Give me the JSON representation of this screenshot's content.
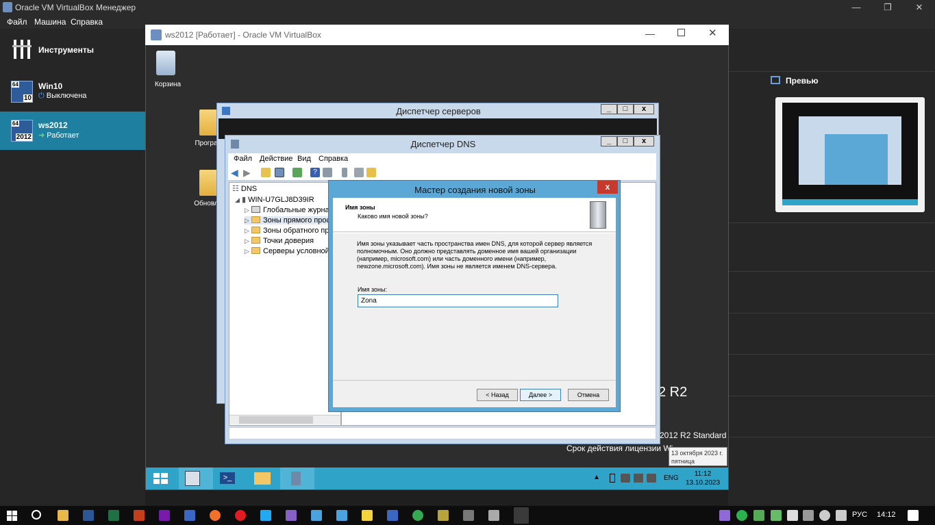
{
  "host_window": {
    "title": "Oracle VM VirtualBox Менеджер",
    "menu": [
      "Файл",
      "Машина",
      "Справка"
    ]
  },
  "sidebar": {
    "tools_label": "Инструменты",
    "vms": [
      {
        "name": "Win10",
        "state": "Выключена",
        "version_badge": "10",
        "arch_badge": "64"
      },
      {
        "name": "ws2012",
        "state": "Работает",
        "version_badge": "2012",
        "arch_badge": "64"
      }
    ]
  },
  "preview": {
    "label": "Превью"
  },
  "vm_window": {
    "title": "ws2012 [Работает] - Oracle VM VirtualBox"
  },
  "guest_desktop": {
    "recycle_bin_label": "Корзина",
    "folder1_label": "Програ",
    "folder2_label": "Обновл",
    "brand_text": "2 R2",
    "edition_text": "2012 R2 Standard",
    "license_text": "Срок действия лицензии Wi",
    "tooltip_line1": "13 октября 2023 г.",
    "tooltip_line2": "пятница"
  },
  "server_manager": {
    "title": "Диспетчер серверов"
  },
  "dns_manager": {
    "title": "Диспетчер DNS",
    "menu": [
      "Файл",
      "Действие",
      "Вид",
      "Справка"
    ],
    "tree": {
      "root": "DNS",
      "server": "WIN-U7GLJ8D39IR",
      "children": [
        "Глобальные журнал",
        "Зоны прямого прос",
        "Зоны обратного про",
        "Точки доверия",
        "Серверы условной п"
      ]
    }
  },
  "wizard": {
    "title": "Мастер создания новой зоны",
    "close_label": "x",
    "heading": "Имя зоны",
    "subheading": "Каково имя новой зоны?",
    "description": "Имя зоны указывает часть пространства имен DNS, для которой сервер является полномочным. Оно должно представлять доменное имя вашей организации (например, microsoft.com) или часть доменного имени (например, newzone.microsoft.com). Имя зоны не является именем DNS-сервера.",
    "field_label": "Имя зоны:",
    "field_value": "Zona",
    "buttons": {
      "back": "< Назад",
      "next": "Далее >",
      "cancel": "Отмена"
    }
  },
  "guest_taskbar": {
    "language": "ENG",
    "time": "11:12",
    "date": "13.10.2023"
  },
  "host_taskbar": {
    "language": "РУС",
    "time": "14:12"
  },
  "colors": {
    "vm_taskbar": "#2fa3c8",
    "wizard_frame": "#5ba7d6",
    "selected_vm": "#1e7fa0",
    "close_button": "#c7392c"
  }
}
